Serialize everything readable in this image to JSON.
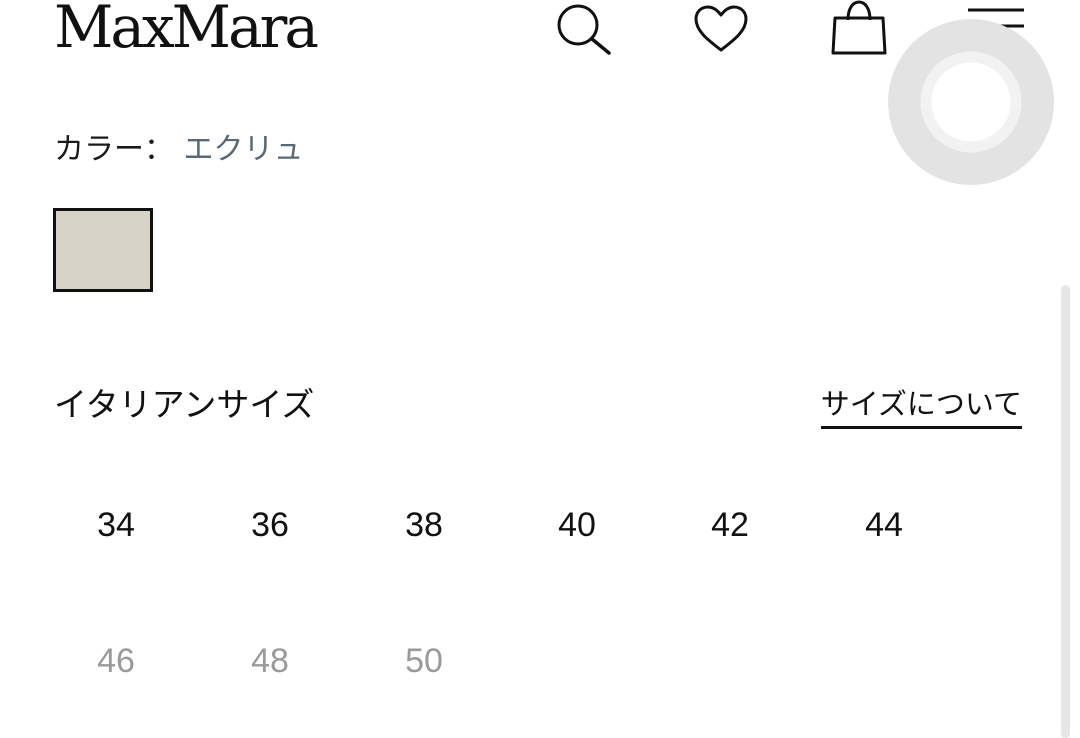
{
  "header": {
    "logo": "MaxMara",
    "icons": [
      "search-icon",
      "heart-icon",
      "bag-icon",
      "menu-icon"
    ]
  },
  "color": {
    "label": "カラー：",
    "value": "エクリュ",
    "swatch_color": "#d6d2c8",
    "value_color": "#5a6978"
  },
  "size_section": {
    "title": "イタリアンサイズ",
    "guide_link": "サイズについて",
    "sizes": [
      {
        "label": "34",
        "available": true
      },
      {
        "label": "36",
        "available": true
      },
      {
        "label": "38",
        "available": true
      },
      {
        "label": "40",
        "available": true
      },
      {
        "label": "42",
        "available": true
      },
      {
        "label": "44",
        "available": true
      },
      {
        "label": "46",
        "available": false
      },
      {
        "label": "48",
        "available": false
      },
      {
        "label": "50",
        "available": false
      }
    ]
  },
  "colors": {
    "text": "#111111",
    "unavailable": "#9a9a9a"
  }
}
